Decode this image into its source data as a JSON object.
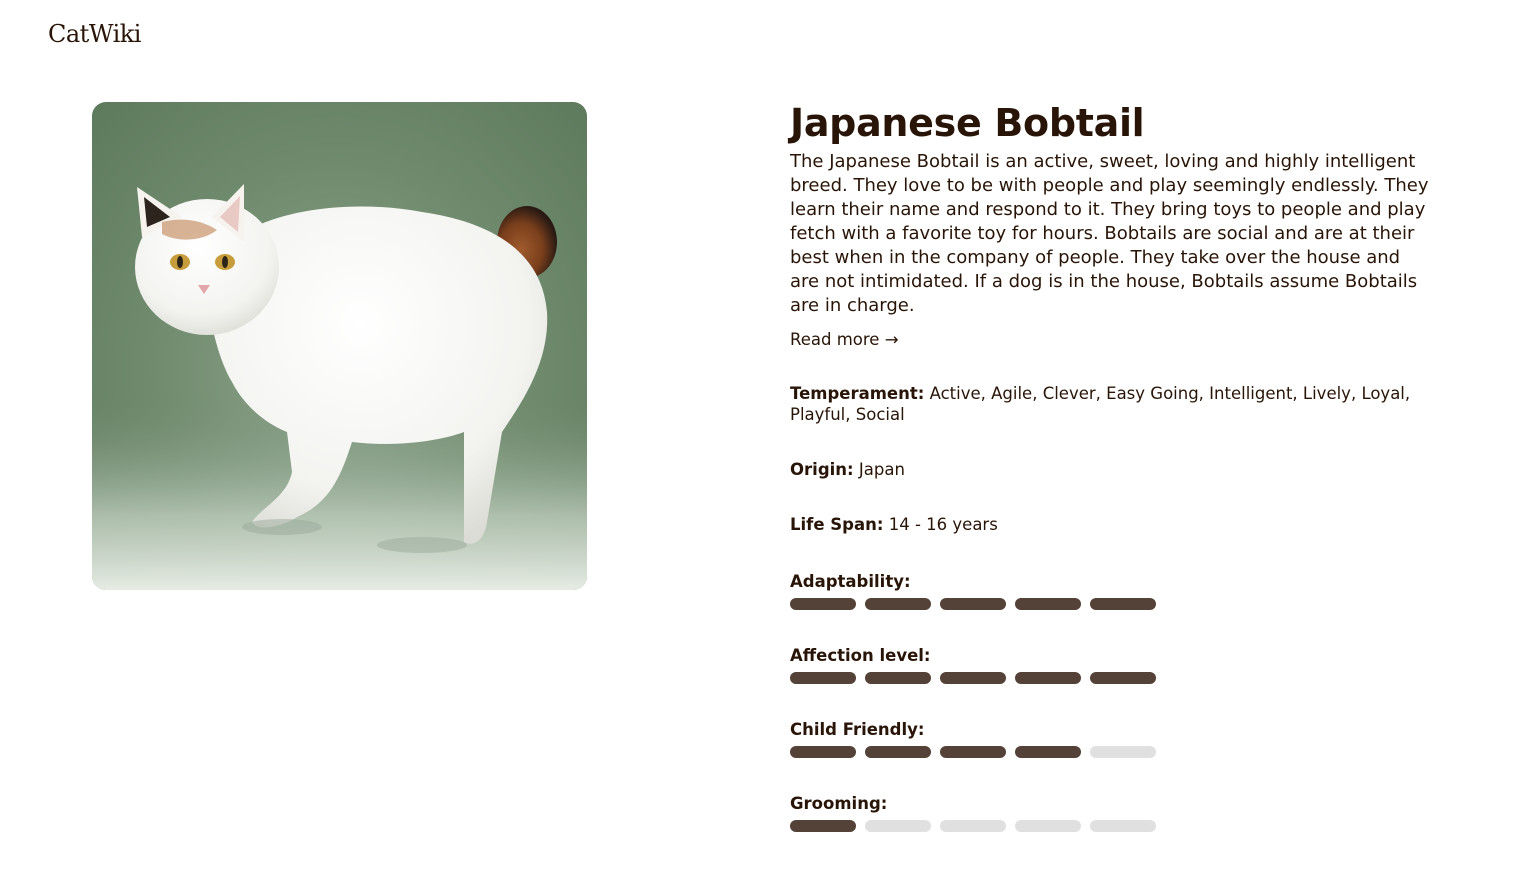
{
  "header": {
    "logo_text": "CatWiki"
  },
  "breed": {
    "name": "Japanese Bobtail",
    "description": "The Japanese Bobtail is an active, sweet, loving and highly intelligent breed. They love to be with people and play seemingly endlessly. They learn their name and respond to it. They bring toys to people and play fetch with a favorite toy for hours. Bobtails are social and are at their best when in the company of people. They take over the house and are not intimidated. If a dog is in the house, Bobtails assume Bobtails are in charge.",
    "read_more": "Read more →",
    "temperament_label": "Temperament:",
    "temperament": "Active, Agile, Clever, Easy Going, Intelligent, Lively, Loyal, Playful, Social",
    "origin_label": "Origin:",
    "origin": "Japan",
    "life_span_label": "Life Span:",
    "life_span": "14 - 16 years",
    "photo_alt": "Japanese Bobtail cat"
  },
  "ratings": [
    {
      "label": "Adaptability:",
      "value": 5,
      "max": 5
    },
    {
      "label": "Affection level:",
      "value": 5,
      "max": 5
    },
    {
      "label": "Child Friendly:",
      "value": 4,
      "max": 5
    },
    {
      "label": "Grooming:",
      "value": 1,
      "max": 5
    }
  ],
  "colors": {
    "text": "#291507",
    "bar_on": "#544238",
    "bar_off": "#e0e0e0"
  }
}
